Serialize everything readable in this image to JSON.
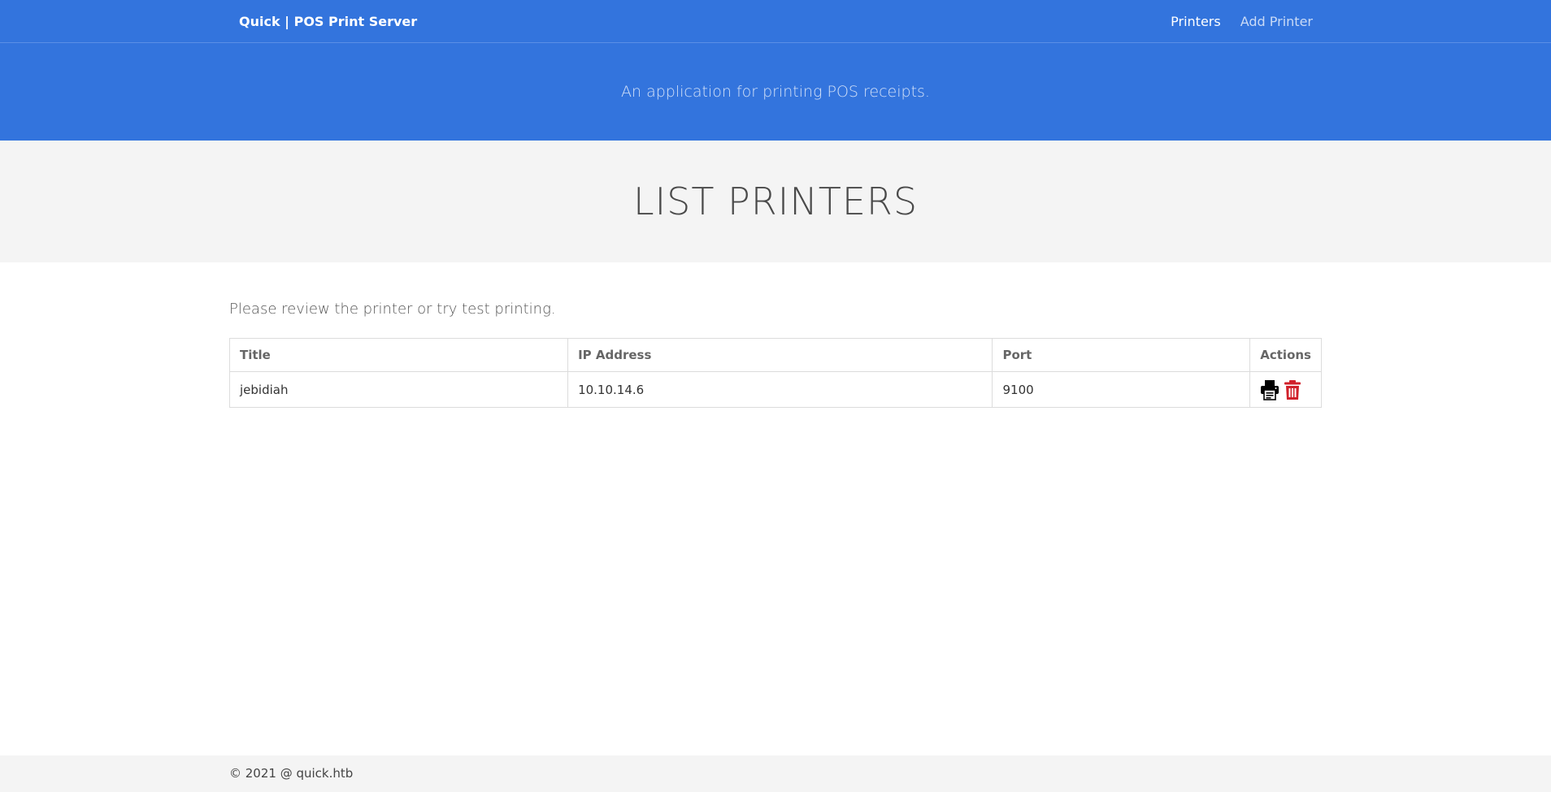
{
  "navbar": {
    "brand": "Quick | POS Print Server",
    "links": [
      {
        "label": "Printers",
        "active": true
      },
      {
        "label": "Add Printer",
        "active": false
      }
    ]
  },
  "hero": {
    "tagline": "An application for printing POS receipts."
  },
  "page": {
    "title": "LIST PRINTERS",
    "intro": "Please review the printer or try test printing."
  },
  "table": {
    "headers": [
      "Title",
      "IP Address",
      "Port",
      "Actions"
    ],
    "rows": [
      {
        "title": "jebidiah",
        "ip": "10.10.14.6",
        "port": "9100",
        "actions": [
          {
            "icon": "printer-icon",
            "color": "#000000"
          },
          {
            "icon": "trash-icon",
            "color": "#d0202a"
          }
        ]
      }
    ]
  },
  "footer": {
    "text": "© 2021 @ quick.htb"
  },
  "colors": {
    "brand_blue": "#3374dd",
    "band_gray": "#f4f4f4",
    "delete_red": "#d0202a"
  }
}
